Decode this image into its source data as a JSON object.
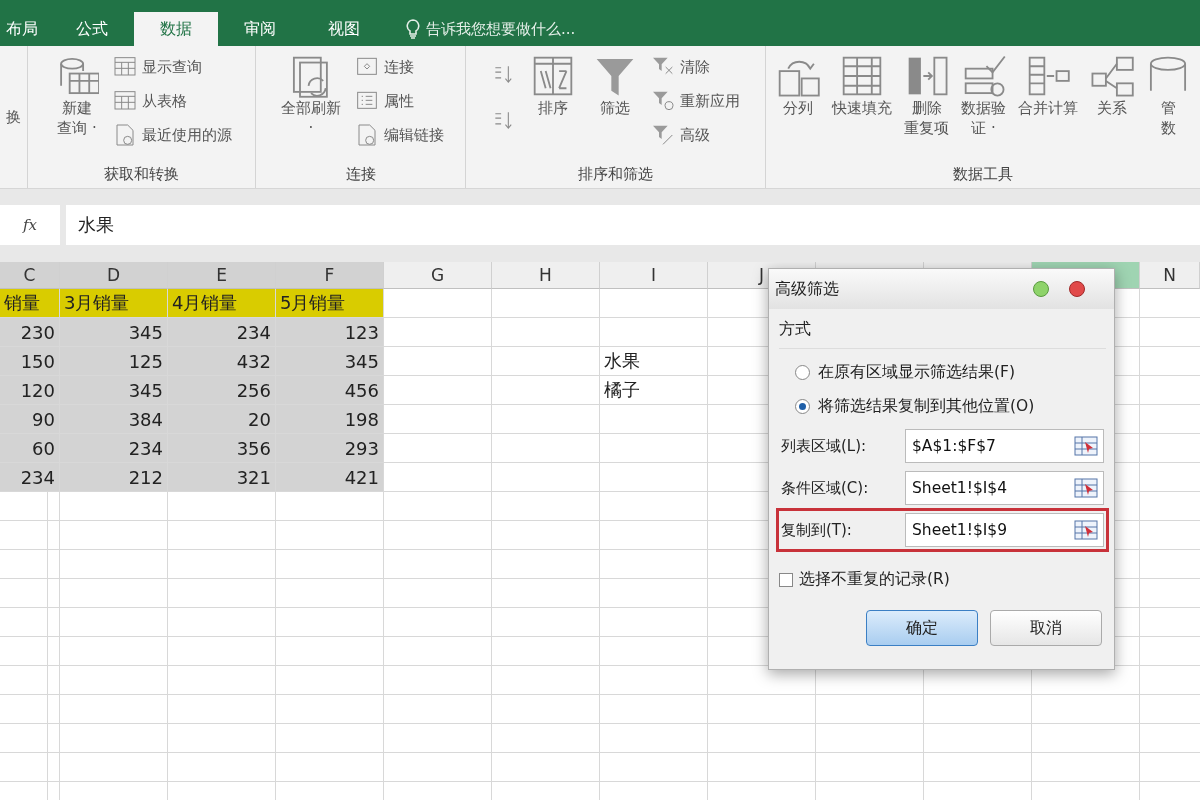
{
  "ribbon": {
    "tabs": [
      {
        "label": "布局",
        "selected": false
      },
      {
        "label": "公式",
        "selected": false
      },
      {
        "label": "数据",
        "selected": true
      },
      {
        "label": "审阅",
        "selected": false
      },
      {
        "label": "视图",
        "selected": false
      }
    ],
    "tell_me": "告诉我您想要做什么...",
    "groups": [
      {
        "items": [
          {
            "kind": "cut",
            "label": "换"
          }
        ]
      },
      {
        "label": "获取和转换",
        "items": [
          {
            "kind": "large",
            "lines": [
              "新建",
              "查询 ·"
            ]
          },
          {
            "kind": "stack",
            "items": [
              "显示查询",
              "从表格",
              "最近使用的源"
            ]
          }
        ]
      },
      {
        "label": "连接",
        "items": [
          {
            "kind": "large",
            "lines": [
              "全部刷新",
              "·"
            ]
          },
          {
            "kind": "stack",
            "items": [
              "连接",
              "属性",
              "编辑链接"
            ]
          }
        ]
      },
      {
        "label": "排序和筛选",
        "items": [
          {
            "kind": "sort"
          },
          {
            "kind": "large",
            "lines": [
              "排序"
            ]
          },
          {
            "kind": "large",
            "lines": [
              "筛选"
            ]
          },
          {
            "kind": "stack",
            "items": [
              "清除",
              "重新应用",
              "高级"
            ]
          }
        ]
      },
      {
        "label": "数据工具",
        "items": [
          {
            "kind": "large",
            "lines": [
              "分列"
            ]
          },
          {
            "kind": "large",
            "lines": [
              "快速填充"
            ]
          },
          {
            "kind": "large",
            "lines": [
              "删除",
              "重复项"
            ]
          },
          {
            "kind": "large",
            "lines": [
              "数据验",
              "证 ·"
            ]
          },
          {
            "kind": "large",
            "lines": [
              "合并计算"
            ]
          },
          {
            "kind": "large",
            "lines": [
              "关系"
            ]
          },
          {
            "kind": "large",
            "lines": [
              "管",
              "数"
            ]
          }
        ]
      }
    ]
  },
  "formula_bar": {
    "fx": "fx",
    "value": "水果"
  },
  "sheet": {
    "columns": [
      {
        "label": "C",
        "selected": true
      },
      {
        "label": "D",
        "selected": true
      },
      {
        "label": "E",
        "selected": true
      },
      {
        "label": "F",
        "selected": true
      },
      {
        "label": "G",
        "selected": false
      },
      {
        "label": "H",
        "selected": false
      },
      {
        "label": "I",
        "selected": false
      },
      {
        "label": "J",
        "selected": false
      },
      {
        "selected": false
      },
      {
        "selected": false
      },
      {
        "selected": false,
        "active": true
      },
      {
        "label": "N",
        "selected": false
      }
    ],
    "rows": [
      {
        "cells": [
          {
            "text": "销量",
            "kind": "header",
            "selected": true
          },
          {
            "text": "3月销量",
            "kind": "header",
            "selected": true
          },
          {
            "text": "4月销量",
            "kind": "header",
            "selected": true
          },
          {
            "text": "5月销量",
            "kind": "header",
            "selected": true
          }
        ]
      },
      {
        "cells": [
          {
            "text": "230",
            "kind": "number",
            "selected": true
          },
          {
            "text": "345",
            "kind": "number",
            "selected": true
          },
          {
            "text": "234",
            "kind": "number",
            "selected": true
          },
          {
            "text": "123",
            "kind": "number",
            "selected": true
          }
        ]
      },
      {
        "cells": [
          {
            "text": "150",
            "kind": "number",
            "selected": true
          },
          {
            "text": "125",
            "kind": "number",
            "selected": true
          },
          {
            "text": "432",
            "kind": "number",
            "selected": true
          },
          {
            "text": "345",
            "kind": "number",
            "selected": true
          },
          null,
          null,
          {
            "text": "水果",
            "kind": "text",
            "selected": false
          }
        ]
      },
      {
        "cells": [
          {
            "text": "120",
            "kind": "number",
            "selected": true
          },
          {
            "text": "345",
            "kind": "number",
            "selected": true
          },
          {
            "text": "256",
            "kind": "number",
            "selected": true
          },
          {
            "text": "456",
            "kind": "number",
            "selected": true
          },
          null,
          null,
          {
            "text": "橘子",
            "kind": "text",
            "selected": false
          }
        ]
      },
      {
        "cells": [
          {
            "text": "90",
            "kind": "number",
            "selected": true
          },
          {
            "text": "384",
            "kind": "number",
            "selected": true
          },
          {
            "text": "20",
            "kind": "number",
            "selected": true
          },
          {
            "text": "198",
            "kind": "number",
            "selected": true
          }
        ]
      },
      {
        "cells": [
          {
            "text": "60",
            "kind": "number",
            "selected": true
          },
          {
            "text": "234",
            "kind": "number",
            "selected": true
          },
          {
            "text": "356",
            "kind": "number",
            "selected": true
          },
          {
            "text": "293",
            "kind": "number",
            "selected": true
          }
        ]
      },
      {
        "cells": [
          {
            "text": "234",
            "kind": "number",
            "selected": true
          },
          {
            "text": "212",
            "kind": "number",
            "selected": true
          },
          {
            "text": "321",
            "kind": "number",
            "selected": true
          },
          {
            "text": "421",
            "kind": "number",
            "selected": true
          }
        ]
      }
    ]
  },
  "dialog": {
    "title": "高级筛选",
    "section": "方式",
    "options": [
      {
        "label": "在原有区域显示筛选结果(F)",
        "selected": false
      },
      {
        "label": "将筛选结果复制到其他位置(O)",
        "selected": true
      }
    ],
    "fields": [
      {
        "label": "列表区域(L):",
        "value": "$A$1:$F$7",
        "highlighted": false
      },
      {
        "label": "条件区域(C):",
        "value": "Sheet1!$I$4",
        "highlighted": false
      },
      {
        "label": "复制到(T):",
        "value": "Sheet1!$I$9",
        "highlighted": true
      }
    ],
    "unique": {
      "label": "选择不重复的记录(R)",
      "checked": false
    },
    "buttons": [
      {
        "label": "确定",
        "default": true
      },
      {
        "label": "取消",
        "default": false
      }
    ]
  }
}
